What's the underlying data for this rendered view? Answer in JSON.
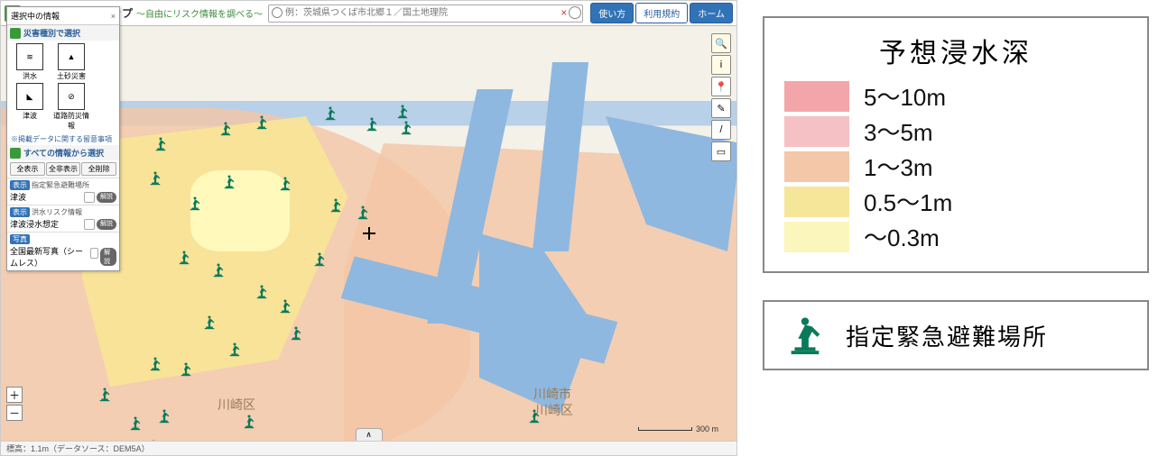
{
  "header": {
    "title": "重ねるハザードマップ",
    "subtitle": "～自由にリスク情報を調べる～",
    "search_placeholder": "例：茨城県つくば市北郷１／国土地理院",
    "btn_howto": "使い方",
    "btn_terms": "利用規約",
    "btn_home": "ホーム"
  },
  "sidepanel": {
    "heading": "選択中の情報",
    "sec_disaster": "災害種別で選択",
    "icons": [
      {
        "label": "洪水",
        "glyph": "≋"
      },
      {
        "label": "土砂災害",
        "glyph": "▲"
      },
      {
        "label": "津波",
        "glyph": "◣"
      },
      {
        "label": "道路防災情報",
        "glyph": "⊘"
      }
    ],
    "note_data": "※掲載データに関する留意事項",
    "sec_all": "すべての情報から選択",
    "btn_show_all": "全表示",
    "btn_hide_all": "全非表示",
    "btn_clear_all": "全削除",
    "btn_legend": "解説",
    "layers": [
      {
        "tag": "表示",
        "cat": "指定緊急避難場所",
        "name": "津波"
      },
      {
        "tag": "表示",
        "cat": "洪水リスク情報",
        "name": "津波浸水想定"
      },
      {
        "tag": "写真",
        "cat": "",
        "name": "全国最新写真（シームレス）"
      }
    ]
  },
  "zoom": {
    "in": "＋",
    "out": "－"
  },
  "toolbox": [
    "🔍",
    "i",
    "📍",
    "✎",
    "/",
    "▭"
  ],
  "map": {
    "scale_label": "300 m",
    "collapse": "∧",
    "labels": {
      "kawasaki_ku_1": "川崎区",
      "kawasaki_shi": "川崎市",
      "kawasaki_ku_2": "川崎区"
    }
  },
  "footer": {
    "elev": "標高：1.1m（データソース：DEM5A）"
  },
  "legend": {
    "title": "予想浸水深",
    "rows": [
      {
        "color": "#f3a6aa",
        "label": "5～10m"
      },
      {
        "color": "#f5c1c4",
        "label": "3～5m"
      },
      {
        "color": "#f3c7a8",
        "label": "1～3m"
      },
      {
        "color": "#f6e69a",
        "label": "0.5～1m"
      },
      {
        "color": "#fbf6bb",
        "label": "～0.3m"
      }
    ],
    "evac_label": "指定緊急避難場所"
  },
  "evac_positions": [
    [
      168,
      122
    ],
    [
      240,
      105
    ],
    [
      280,
      98
    ],
    [
      356,
      88
    ],
    [
      402,
      100
    ],
    [
      436,
      86
    ],
    [
      440,
      104
    ],
    [
      162,
      160
    ],
    [
      206,
      188
    ],
    [
      244,
      164
    ],
    [
      306,
      166
    ],
    [
      362,
      190
    ],
    [
      392,
      198
    ],
    [
      344,
      250
    ],
    [
      194,
      248
    ],
    [
      232,
      262
    ],
    [
      280,
      286
    ],
    [
      306,
      302
    ],
    [
      222,
      320
    ],
    [
      250,
      350
    ],
    [
      318,
      332
    ],
    [
      162,
      366
    ],
    [
      196,
      372
    ],
    [
      106,
      400
    ],
    [
      140,
      432
    ],
    [
      160,
      458
    ],
    [
      172,
      424
    ],
    [
      266,
      430
    ],
    [
      582,
      424
    ]
  ]
}
